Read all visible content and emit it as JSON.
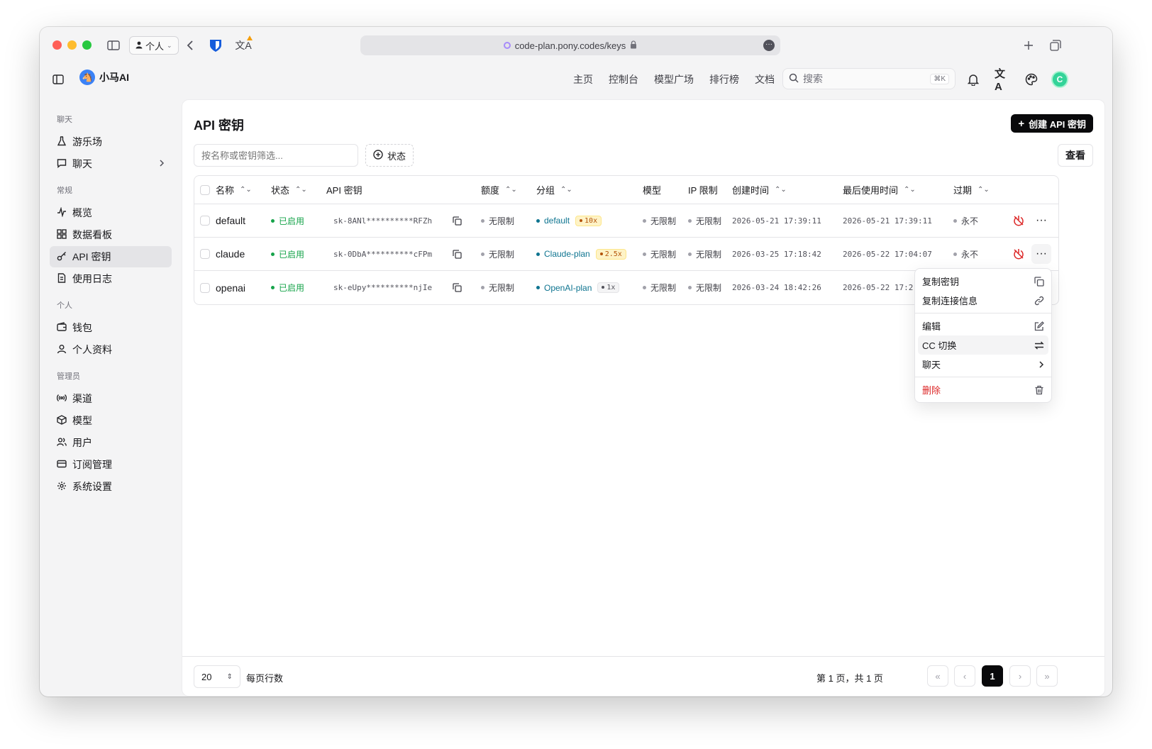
{
  "browser": {
    "profile_label": "个人",
    "url": "code-plan.pony.codes/keys"
  },
  "app": {
    "brand": "小马AI",
    "nav": [
      "主页",
      "控制台",
      "模型广场",
      "排行榜",
      "文档"
    ],
    "search_placeholder": "搜索",
    "search_shortcut": "⌘K",
    "avatar_letter": "C"
  },
  "sidebar": {
    "groups": [
      {
        "label": "聊天",
        "items": [
          "游乐场",
          "聊天"
        ]
      },
      {
        "label": "常规",
        "items": [
          "概览",
          "数据看板",
          "API 密钥",
          "使用日志"
        ]
      },
      {
        "label": "个人",
        "items": [
          "钱包",
          "个人资料"
        ]
      },
      {
        "label": "管理员",
        "items": [
          "渠道",
          "模型",
          "用户",
          "订阅管理",
          "系统设置"
        ]
      }
    ],
    "active": "API 密钥"
  },
  "page": {
    "title": "API 密钥",
    "create_label": "创建 API 密钥",
    "filter_placeholder": "按名称或密钥筛选...",
    "status_filter": "状态",
    "view_label": "查看"
  },
  "table": {
    "headers": [
      "名称",
      "状态",
      "API 密钥",
      "额度",
      "分组",
      "模型",
      "IP 限制",
      "创建时间",
      "最后使用时间",
      "过期"
    ],
    "rows": [
      {
        "name": "default",
        "status": "已启用",
        "key": "sk-8ANl**********RFZh",
        "quota": "无限制",
        "group": "default",
        "ratio": "10x",
        "model": "无限制",
        "ip": "无限制",
        "created": "2026-05-21 17:39:11",
        "last_used": "2026-05-21 17:39:11",
        "expiry": "永不"
      },
      {
        "name": "claude",
        "status": "已启用",
        "key": "sk-0DbA**********cFPm",
        "quota": "无限制",
        "group": "Claude-plan",
        "ratio": "2.5x",
        "model": "无限制",
        "ip": "无限制",
        "created": "2026-03-25 17:18:42",
        "last_used": "2026-05-22 17:04:07",
        "expiry": "永不"
      },
      {
        "name": "openai",
        "status": "已启用",
        "key": "sk-eUpy**********njIe",
        "quota": "无限制",
        "group": "OpenAI-plan",
        "ratio": "1x",
        "model": "无限制",
        "ip": "无限制",
        "created": "2026-03-24 18:42:26",
        "last_used": "2026-05-22 17:2",
        "expiry": ""
      }
    ]
  },
  "context_menu": {
    "items": [
      "复制密钥",
      "复制连接信息",
      "编辑",
      "CC 切换",
      "聊天",
      "删除"
    ]
  },
  "pagination": {
    "page_size": "20",
    "rows_label": "每页行数",
    "page_info": "第 1 页，共 1 页",
    "current_page": "1"
  },
  "colors": {
    "enabled": "#16a34a",
    "group": "#0e7490",
    "danger": "#dc2626",
    "primary": "#09090b"
  }
}
